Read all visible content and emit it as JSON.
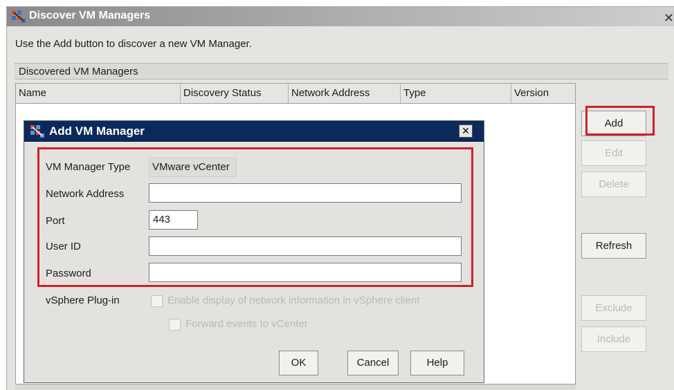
{
  "window": {
    "title": "Discover VM Managers",
    "close_glyph": "✕",
    "icon": "vm-manager-icon"
  },
  "instruction": "Use the Add button to discover a new VM Manager.",
  "group": {
    "label": "Discovered VM Managers"
  },
  "table": {
    "columns": [
      "Name",
      "Discovery Status",
      "Network Address",
      "Type",
      "Version"
    ],
    "rows": []
  },
  "side_buttons": {
    "add": "Add",
    "edit": "Edit",
    "delete": "Delete",
    "refresh": "Refresh",
    "exclude": "Exclude",
    "include": "Include"
  },
  "dialog": {
    "title": "Add VM Manager",
    "close_glyph": "✕",
    "icon": "vm-manager-icon",
    "fields": {
      "type_label": "VM Manager Type",
      "type_value": "VMware vCenter",
      "address_label": "Network Address",
      "address_value": "",
      "port_label": "Port",
      "port_value": "443",
      "userid_label": "User ID",
      "userid_value": "",
      "password_label": "Password",
      "password_value": ""
    },
    "plugin": {
      "label": "vSphere Plug-in",
      "option1": "Enable display of network information in vSphere client",
      "option2": "Forward events to vCenter"
    },
    "buttons": {
      "ok": "OK",
      "cancel": "Cancel",
      "help": "Help"
    }
  },
  "colors": {
    "highlight": "#d0202a",
    "dialog_title_bg": "#0b2a5b"
  }
}
